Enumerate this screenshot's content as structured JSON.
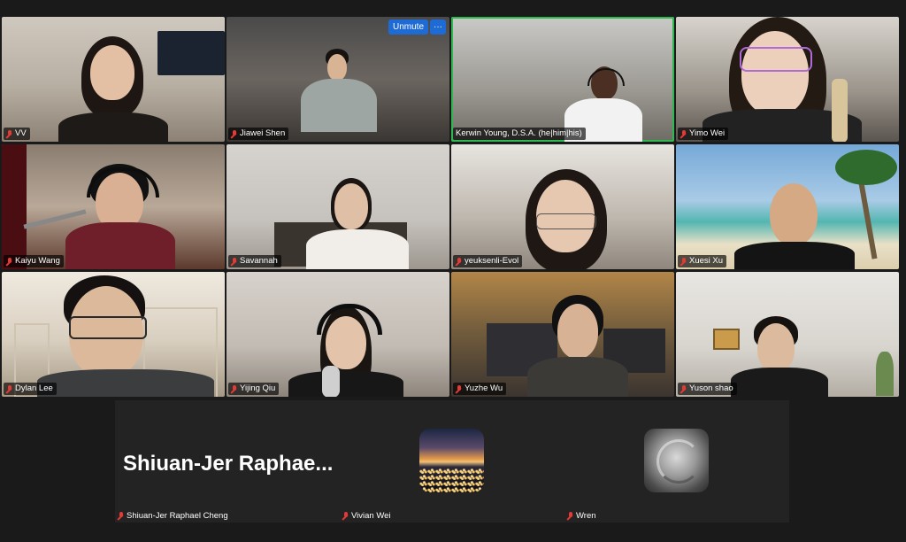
{
  "colors": {
    "background": "#1a1a1a",
    "active_speaker_border": "#2fb84f",
    "muted_icon": "#e53935",
    "button_blue": "#1f6bd6",
    "name_tag_bg": "rgba(0,0,0,0.65)"
  },
  "tile_controls": {
    "unmute_label": "Unmute",
    "more_label": "···"
  },
  "participants": [
    {
      "name": "VV",
      "muted": true
    },
    {
      "name": "Jiawei Shen",
      "muted": true
    },
    {
      "name": "Kerwin Young, D.S.A. (he|him|his)",
      "muted": false,
      "active_speaker": true
    },
    {
      "name": "Yimo Wei",
      "muted": true
    },
    {
      "name": "Kaiyu Wang",
      "muted": true
    },
    {
      "name": "Savannah",
      "muted": true
    },
    {
      "name": "yeuksenli-Evol",
      "muted": true
    },
    {
      "name": "Xuesi Xu",
      "muted": true
    },
    {
      "name": "Dylan Lee",
      "muted": true
    },
    {
      "name": "Yijing Qiu",
      "muted": true
    },
    {
      "name": "Yuzhe Wu",
      "muted": true
    },
    {
      "name": "Yuson shao",
      "muted": true
    }
  ],
  "no_video": [
    {
      "display": "Shiuan-Jer Raphae...",
      "name": "Shiuan-Jer Raphael Cheng",
      "muted": true
    },
    {
      "name": "Vivian Wei",
      "muted": true,
      "avatar": "city-sunset-avatar"
    },
    {
      "name": "Wren",
      "muted": true,
      "avatar": "shell-avatar"
    }
  ]
}
